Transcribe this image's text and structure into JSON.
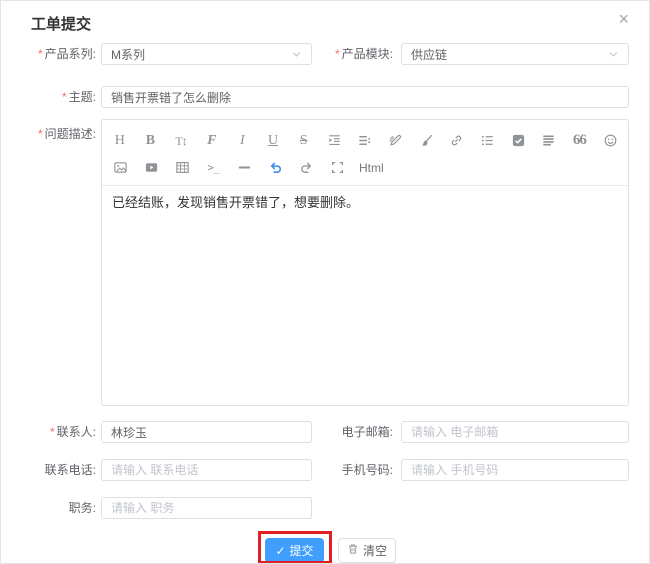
{
  "dialog": {
    "title": "工单提交",
    "close_glyph": "×",
    "required_mark": "*"
  },
  "fields": {
    "product_series": {
      "label": "产品系列:",
      "value": "M系列"
    },
    "product_module": {
      "label": "产品模块:",
      "value": "供应链"
    },
    "subject": {
      "label": "主题:",
      "value": "销售开票错了怎么删除"
    },
    "description": {
      "label": "问题描述:",
      "content": "已经结账，发现销售开票错了，想要删除。"
    },
    "contact_name": {
      "label": "联系人:",
      "value": "林珍玉"
    },
    "email": {
      "label": "电子邮箱:",
      "placeholder": "请输入 电子邮箱"
    },
    "telephone": {
      "label": "联系电话:",
      "placeholder": "请输入 联系电话"
    },
    "mobile": {
      "label": "手机号码:",
      "placeholder": "请输入 手机号码"
    },
    "job_title": {
      "label": "职务:",
      "placeholder": "请输入 职务"
    }
  },
  "editor": {
    "toolbar_row1": [
      {
        "name": "heading",
        "glyph": "H"
      },
      {
        "name": "bold",
        "glyph": "B"
      },
      {
        "name": "font-size",
        "glyph": "T↕"
      },
      {
        "name": "font-family",
        "glyph": "F"
      },
      {
        "name": "italic",
        "glyph": "I"
      },
      {
        "name": "underline",
        "glyph": "U"
      },
      {
        "name": "strikethrough",
        "glyph": "S"
      },
      {
        "name": "indent",
        "glyph": ""
      },
      {
        "name": "line-height",
        "glyph": ""
      },
      {
        "name": "font-color",
        "glyph": ""
      },
      {
        "name": "background-color",
        "glyph": ""
      },
      {
        "name": "link",
        "glyph": ""
      },
      {
        "name": "bulleted-list",
        "glyph": ""
      },
      {
        "name": "todo",
        "glyph": ""
      },
      {
        "name": "justify",
        "glyph": ""
      },
      {
        "name": "quote",
        "glyph": "66"
      },
      {
        "name": "emoji",
        "glyph": ""
      }
    ],
    "toolbar_row2": [
      {
        "name": "image",
        "glyph": ""
      },
      {
        "name": "video",
        "glyph": ""
      },
      {
        "name": "table",
        "glyph": ""
      },
      {
        "name": "code",
        "glyph": ">_"
      },
      {
        "name": "divider",
        "glyph": ""
      },
      {
        "name": "undo",
        "glyph": ""
      },
      {
        "name": "redo",
        "glyph": ""
      },
      {
        "name": "fullscreen",
        "glyph": ""
      },
      {
        "name": "html",
        "glyph": "Html"
      }
    ]
  },
  "footer": {
    "submit_check_glyph": "✓",
    "submit_label": "提交",
    "clear_label": "清空"
  },
  "colors": {
    "primary_blue": "#409eff",
    "annotation_red": "#e02020",
    "undo_active_blue": "#3b8cf0",
    "required_red": "#f56c6c"
  }
}
